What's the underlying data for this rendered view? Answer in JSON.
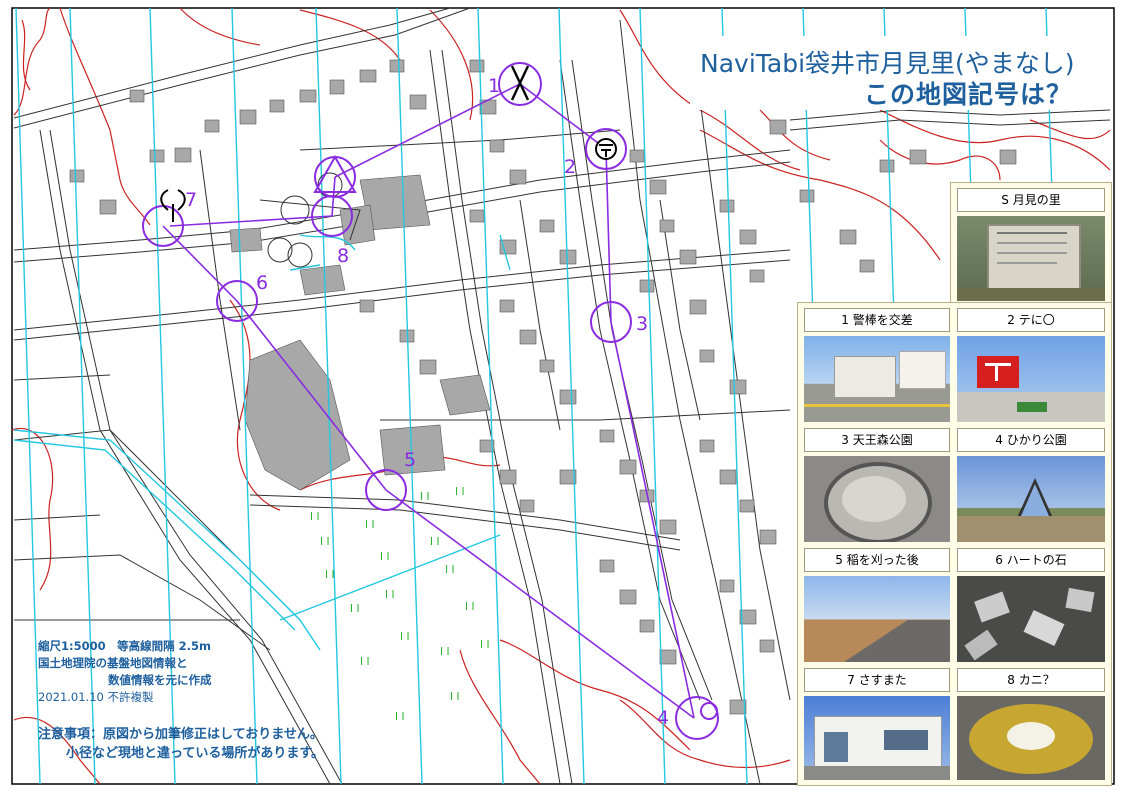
{
  "title": {
    "line1": "NaviTabi袋井市月見里(やまなし)",
    "line2": "この地図記号は？"
  },
  "controls": [
    "1",
    "2",
    "3",
    "4",
    "5",
    "6",
    "7",
    "8"
  ],
  "photos": {
    "s": "S 月見の里",
    "p1": "1  警棒を交差",
    "p2": "2  テに〇",
    "p3": "3  天王森公園",
    "p4": "4  ひかり公園",
    "p5": "5  稲を刈った後",
    "p6": "6  ハートの石",
    "p7": "7 さすまた",
    "p8": "8  カニ？"
  },
  "info": {
    "scale": "縮尺1:5000　等高線間隔  2.5m",
    "source1": "国土地理院の基盤地図情報と",
    "source2": "数値情報を元に作成",
    "date": "2021.01.10 不許複製"
  },
  "notice": {
    "line1": "注意事項：原図から加筆修正はしておりません。",
    "line2": "小径など現地と違っている場所があります。"
  },
  "colors": {
    "course": "#8a2be2",
    "title": "#1e5f9e",
    "contour": "#cc2222",
    "water": "#22c8e0",
    "building": "#a8a8a8"
  }
}
